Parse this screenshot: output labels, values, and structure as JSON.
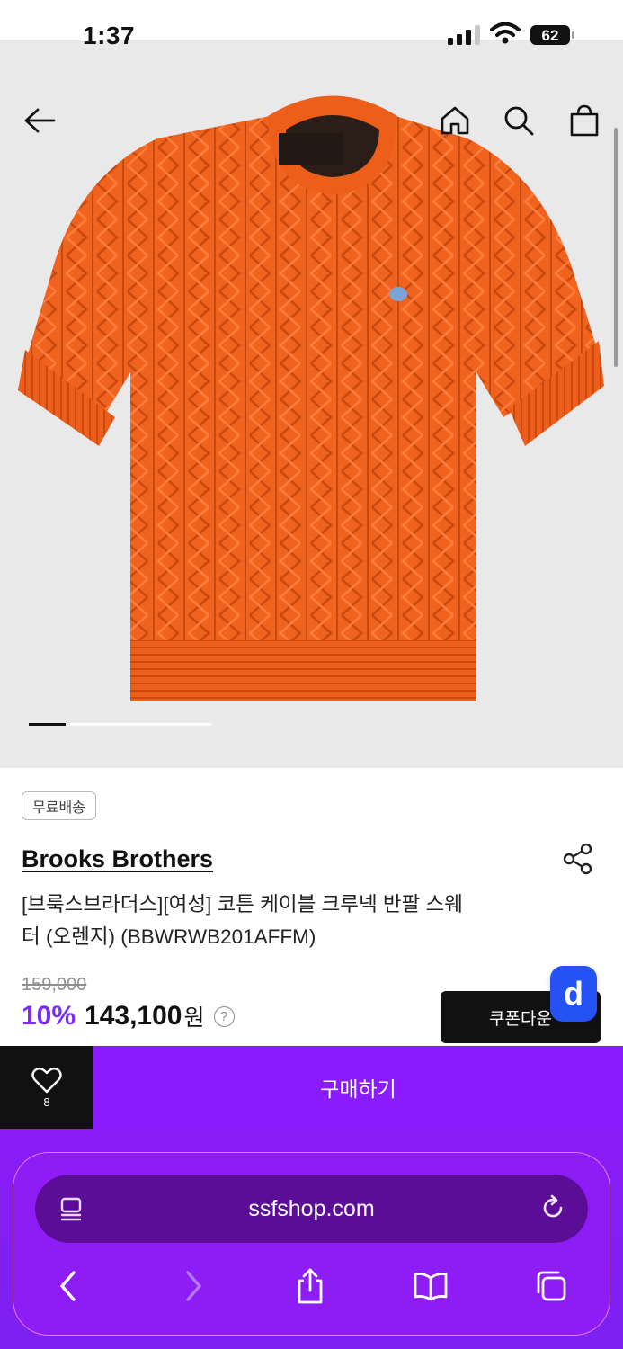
{
  "status_bar": {
    "time": "1:37",
    "battery": "62"
  },
  "header": {
    "icons": [
      "back-arrow-icon",
      "home-icon",
      "search-icon",
      "shopping-bag-icon"
    ]
  },
  "gallery": {
    "current_slide_fraction": 0.2
  },
  "product": {
    "shipping_badge": "무료배송",
    "brand": "Brooks Brothers",
    "name_line1": "[브룩스브라더스][여성] 코튼 케이블 크루넥 반팔 스웨",
    "name_line2": "터 (오렌지) (BBWRWB201AFFM)",
    "original_price": "159,000",
    "discount": "10%",
    "price": "143,100",
    "currency": "원",
    "help_glyph": "?",
    "coupon_label": "쿠폰다운",
    "fab_letter": "d"
  },
  "action_bar": {
    "like_count": "8",
    "buy_label": "구매하기"
  },
  "browser": {
    "url": "ssfshop.com"
  },
  "colors": {
    "accent_purple": "#8b1bff",
    "discount_purple": "#7a2bff",
    "sweater_orange": "#f0631e",
    "fab_blue": "#2452f5"
  }
}
